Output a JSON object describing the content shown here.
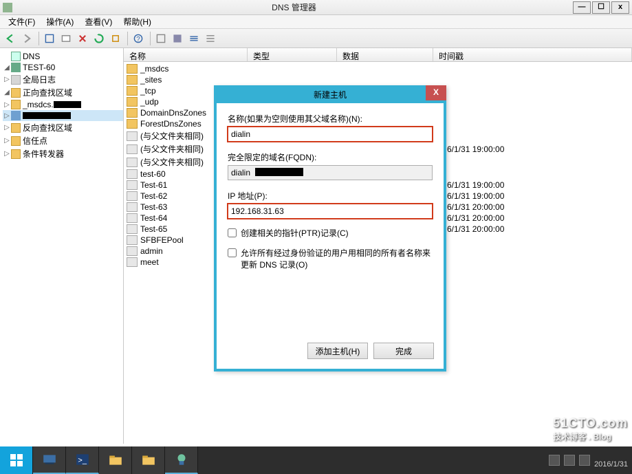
{
  "window": {
    "title": "DNS 管理器",
    "min": "—",
    "max": "☐",
    "close": "x"
  },
  "menu": {
    "file": "文件(F)",
    "action": "操作(A)",
    "view": "查看(V)",
    "help": "帮助(H)"
  },
  "tree": {
    "root": "DNS",
    "server": "TEST-60",
    "globalLog": "全局日志",
    "forwardZone": "正向查找区域",
    "msdcs": "_msdcs.",
    "zone2": "",
    "reverseZone": "反向查找区域",
    "trustPoints": "信任点",
    "condForward": "条件转发器"
  },
  "columns": {
    "name": "名称",
    "type": "类型",
    "data": "数据",
    "timestamp": "时间戳"
  },
  "items": [
    {
      "name": "_msdcs",
      "icon": "folder",
      "time": ""
    },
    {
      "name": "_sites",
      "icon": "folder",
      "time": ""
    },
    {
      "name": "_tcp",
      "icon": "folder",
      "time": ""
    },
    {
      "name": "_udp",
      "icon": "folder",
      "time": ""
    },
    {
      "name": "DomainDnsZones",
      "icon": "folder",
      "time": ""
    },
    {
      "name": "ForestDnsZones",
      "icon": "folder",
      "time": ""
    },
    {
      "name": "(与父文件夹相同)",
      "icon": "host",
      "time": ""
    },
    {
      "name": "(与父文件夹相同)",
      "icon": "host",
      "time": "6/1/31 19:00:00"
    },
    {
      "name": "(与父文件夹相同)",
      "icon": "host",
      "time": ""
    },
    {
      "name": "test-60",
      "icon": "host",
      "time": ""
    },
    {
      "name": "Test-61",
      "icon": "host",
      "time": "6/1/31 19:00:00"
    },
    {
      "name": "Test-62",
      "icon": "host",
      "time": "6/1/31 19:00:00"
    },
    {
      "name": "Test-63",
      "icon": "host",
      "time": "6/1/31 20:00:00"
    },
    {
      "name": "Test-64",
      "icon": "host",
      "time": "6/1/31 20:00:00"
    },
    {
      "name": "Test-65",
      "icon": "host",
      "time": "6/1/31 20:00:00"
    },
    {
      "name": "SFBFEPool",
      "icon": "host",
      "time": ""
    },
    {
      "name": "admin",
      "icon": "host",
      "time": ""
    },
    {
      "name": "meet",
      "icon": "host",
      "time": ""
    }
  ],
  "dialog": {
    "title": "新建主机",
    "nameLabel": "名称(如果为空则使用其父域名称)(N):",
    "nameValue": "dialin",
    "fqdnLabel": "完全限定的域名(FQDN):",
    "fqdnValue": "dialin",
    "ipLabel": "IP 地址(P):",
    "ipValue": "192.168.31.63",
    "ptrLabel": "创建相关的指针(PTR)记录(C)",
    "allowLabel": "允许所有经过身份验证的用户用相同的所有者名称来更新 DNS 记录(O)",
    "addHost": "添加主机(H)",
    "done": "完成"
  },
  "taskbar": {
    "date": "2016/1/31"
  },
  "watermark": {
    "main": "51CTO.com",
    "sub": "技术博客 . Blog"
  }
}
